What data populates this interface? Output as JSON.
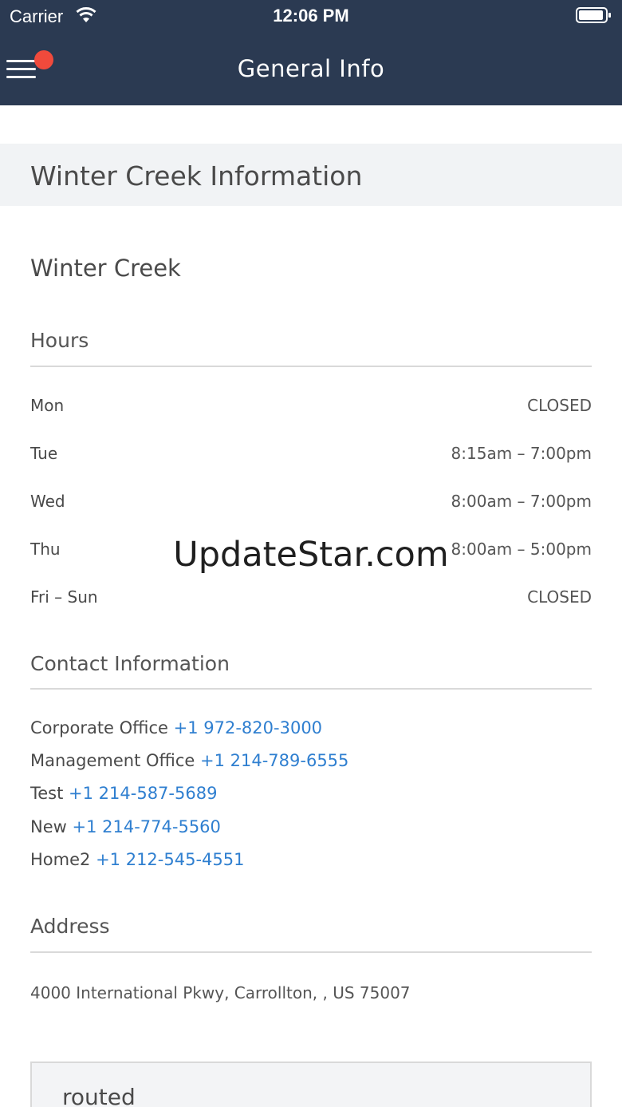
{
  "status_bar": {
    "carrier": "Carrier",
    "time": "12:06 PM",
    "wifi_icon": "wifi-icon",
    "battery_icon": "battery-icon"
  },
  "nav": {
    "title": "General Info",
    "menu_icon": "hamburger-menu-icon",
    "notification_color": "#f04a3c",
    "background": "#2b3a52"
  },
  "section": {
    "title": "Winter Creek Information"
  },
  "community": {
    "name": "Winter Creek"
  },
  "hours": {
    "heading": "Hours",
    "rows": [
      {
        "day": "Mon",
        "value": "CLOSED"
      },
      {
        "day": "Tue",
        "value": "8:15am – 7:00pm"
      },
      {
        "day": "Wed",
        "value": "8:00am – 7:00pm"
      },
      {
        "day": "Thu",
        "value": "8:00am – 5:00pm"
      },
      {
        "day": "Fri – Sun",
        "value": "CLOSED"
      }
    ]
  },
  "contact": {
    "heading": "Contact Information",
    "link_color": "#2f7fd0",
    "rows": [
      {
        "label": "Corporate Office",
        "phone": "+1 972-820-3000"
      },
      {
        "label": "Management Office",
        "phone": "+1 214-789-6555"
      },
      {
        "label": "Test",
        "phone": "+1 214-587-5689"
      },
      {
        "label": "New",
        "phone": "+1 214-774-5560"
      },
      {
        "label": "Home2",
        "phone": "+1 212-545-4551"
      }
    ]
  },
  "address": {
    "heading": "Address",
    "text": "4000 International Pkwy, Carrollton, , US 75007"
  },
  "watermark": "UpdateStar.com",
  "card": {
    "title": "routed"
  }
}
